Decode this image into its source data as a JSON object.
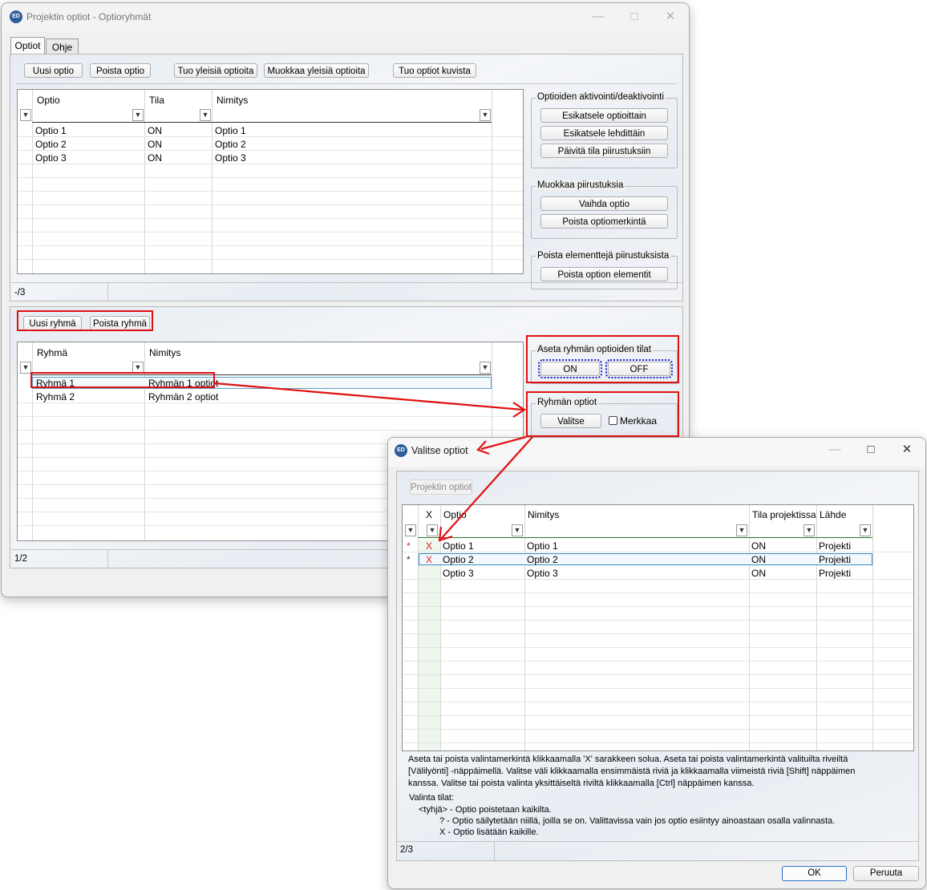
{
  "main_window": {
    "icon": "ED",
    "title": "Projektin optiot - Optioryhmät",
    "tabs": [
      "Optiot",
      "Ohje"
    ],
    "toolbar": [
      "Uusi optio",
      "Poista optio",
      "Tuo yleisiä optioita",
      "Muokkaa yleisiä optioita",
      "Tuo optiot kuvista"
    ],
    "options_grid": {
      "headers": [
        "Optio",
        "Tila",
        "Nimitys"
      ],
      "rows": [
        {
          "optio": "Optio 1",
          "tila": "ON",
          "nimitys": "Optio 1"
        },
        {
          "optio": "Optio 2",
          "tila": "ON",
          "nimitys": "Optio 2"
        },
        {
          "optio": "Optio 3",
          "tila": "ON",
          "nimitys": "Optio 3"
        }
      ],
      "status": "-/3"
    },
    "activation_group": {
      "title": "Optioiden aktivointi/deaktivointi",
      "buttons": [
        "Esikatsele optioittain",
        "Esikatsele lehdittäin",
        "Päivitä tila piirustuksiin"
      ]
    },
    "edit_group": {
      "title": "Muokkaa piirustuksia",
      "buttons": [
        "Vaihda optio",
        "Poista optiomerkintä"
      ]
    },
    "remove_group": {
      "title": "Poista elementtejä piirustuksista",
      "buttons": [
        "Poista option elementit"
      ]
    },
    "group_toolbar": [
      "Uusi ryhmä",
      "Poista ryhmä"
    ],
    "groups_grid": {
      "headers": [
        "Ryhmä",
        "Nimitys"
      ],
      "rows": [
        {
          "ryhma": "Ryhmä 1",
          "nimitys": "Ryhmän 1 optiot"
        },
        {
          "ryhma": "Ryhmä 2",
          "nimitys": "Ryhmän 2 optiot"
        }
      ],
      "status": "1/2"
    },
    "set_state_group": {
      "title": "Aseta ryhmän optioiden tilat",
      "on": "ON",
      "off": "OFF"
    },
    "group_options": {
      "title": "Ryhmän optiot",
      "select": "Valitse",
      "checkbox": "Merkkaa",
      "checked": false
    }
  },
  "dialog": {
    "icon": "ED",
    "title": "Valitse optiot",
    "tab": "Projektin optiot",
    "grid": {
      "headers": [
        "X",
        "Optio",
        "Nimitys",
        "Tila projektissa",
        "Lähde"
      ],
      "rows": [
        {
          "mark": "*",
          "x": "X",
          "optio": "Optio 1",
          "nimitys": "Optio 1",
          "tila": "ON",
          "lahde": "Projekti"
        },
        {
          "mark": "*",
          "x": "X",
          "optio": "Optio 2",
          "nimitys": "Optio 2",
          "tila": "ON",
          "lahde": "Projekti"
        },
        {
          "mark": "",
          "x": "",
          "optio": "Optio 3",
          "nimitys": "Optio 3",
          "tila": "ON",
          "lahde": "Projekti"
        }
      ]
    },
    "help": {
      "line1": "Aseta tai poista valintamerkintä klikkaamalla 'X' sarakkeen solua. Aseta tai poista valintamerkintä valituilta riveiltä",
      "line2": "[Välilyönti] -näppäimellä. Valitse väli klikkaamalla ensimmäistä riviä ja klikkaamalla viimeistä riviä [Shift] näppäimen",
      "line3": "kanssa. Valitse tai poista valinta yksittäiseltä riviltä klikkaamalla [Ctrl] näppäimen kanssa.",
      "states_title": "Valinta tilat:",
      "state_empty": "<tyhjä> - Optio poistetaan kaikilta.",
      "state_q": "? - Optio säilytetään niillä, joilla se on. Valittavissa vain jos optio esiintyy ainoastaan osalla valinnasta.",
      "state_x": "X - Optio lisätään kaikille."
    },
    "status": "2/3",
    "ok": "OK",
    "cancel": "Peruuta"
  },
  "colors": {
    "annotation_red": "#e01010",
    "focus_blue": "#2020c8",
    "x_mark": "#d02020"
  }
}
